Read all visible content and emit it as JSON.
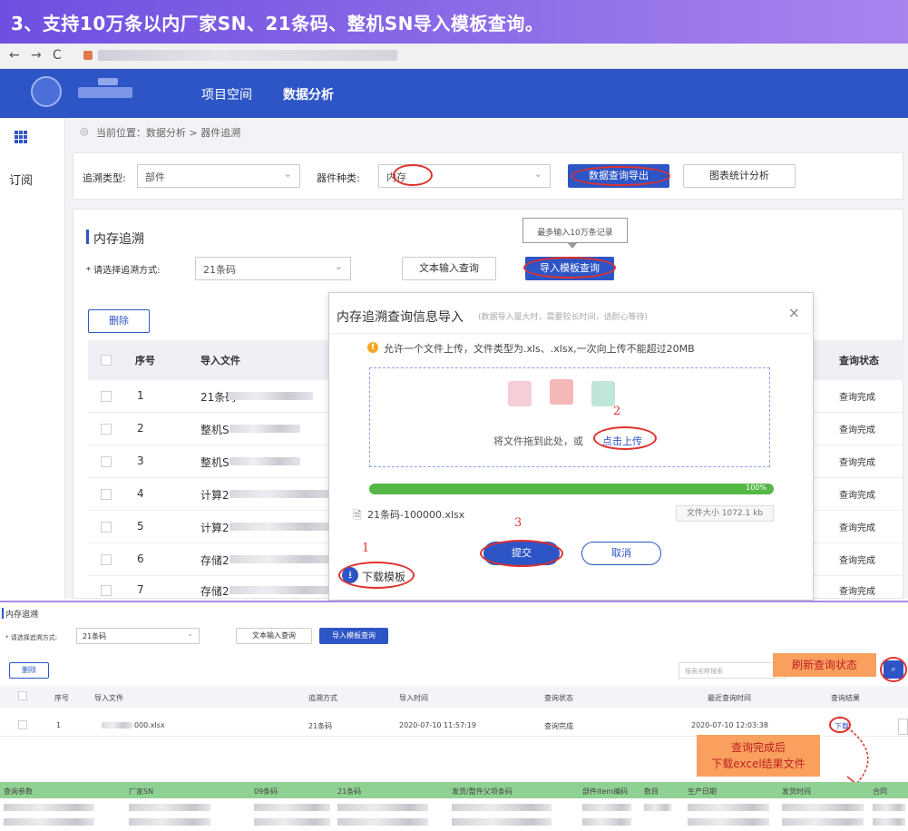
{
  "banner": {
    "title": "3、支持10万条以内厂家SN、21条码、整机SN导入模板查询。"
  },
  "browser": {
    "back": "←",
    "forward": "→",
    "reload": "C"
  },
  "topnav": {
    "items": [
      "项目空间",
      "数据分析"
    ]
  },
  "sidebar": {
    "sub_label": "订阅"
  },
  "breadcrumb": "当前位置：数据分析 > 器件追溯",
  "filter": {
    "trace_type_label": "追溯类型:",
    "trace_type_value": "部件",
    "device_type_label": "器件种类:",
    "device_type_value": "内存",
    "export_button": "数据查询导出",
    "chart_button": "图表统计分析"
  },
  "panel": {
    "title": "内存追溯",
    "method_label": "* 请选择追溯方式:",
    "method_value": "21条码",
    "text_query_button": "文本输入查询",
    "template_query_button": "导入模板查询",
    "tooltip": "最多输入10万条记录",
    "delete_button": "删除",
    "columns": [
      "序号",
      "导入文件",
      "查询状态"
    ],
    "rows": [
      {
        "no": "1",
        "file": "21条码",
        "status": "查询完成"
      },
      {
        "no": "2",
        "file": "整机S",
        "status": "查询完成"
      },
      {
        "no": "3",
        "file": "整机S",
        "status": "查询完成"
      },
      {
        "no": "4",
        "file": "计算2",
        "status": "查询完成"
      },
      {
        "no": "5",
        "file": "计算2",
        "status": "查询完成"
      },
      {
        "no": "6",
        "file": "存储2",
        "status": "查询完成"
      },
      {
        "no": "7",
        "file": "存储2",
        "status": "查询完成"
      }
    ]
  },
  "modal": {
    "title": "内存追溯查询信息导入",
    "subtitle": "(数据导入量大时，需要较长时间，请耐心等待)",
    "close": "×",
    "notice": "允许一个文件上传，文件类型为.xls、.xlsx,一次向上传不能超过20MB",
    "drop_text": "将文件拖到此处，或",
    "drop_link": "点击上传",
    "progress_percent": 100,
    "progress_label": "100%",
    "file_name": "21条码-100000.xlsx",
    "file_size": "文件大小 1072.1 kb",
    "submit_button": "提交",
    "cancel_button": "取消",
    "download_template": "下载模板",
    "step_marks": [
      "1",
      "2",
      "3"
    ]
  },
  "bottom": {
    "title": "内存追溯",
    "method_label": "* 请选择追溯方式:",
    "method_value": "21条码",
    "text_query_button": "文本输入查询",
    "template_query_button": "导入模板查询",
    "delete_button": "删除",
    "search_placeholder": "报表名称搜索",
    "refresh_callout": "刷新查询状态",
    "columns": [
      "序号",
      "导入文件",
      "追溯方式",
      "导入时间",
      "查询状态",
      "最近查询时间",
      "查询结果"
    ],
    "row": {
      "no": "1",
      "file": "000.xlsx",
      "method": "21条码",
      "import_time": "2020-07-10 11:57:19",
      "status": "查询完成",
      "last_query": "2020-07-10 12:03:38",
      "result": "下载"
    },
    "download_callout_line1": "查询完成后",
    "download_callout_line2": "下载excel结果文件",
    "result_columns": [
      "查询参数",
      "厂家SN",
      "09条码",
      "21条码",
      "发货/整件父项条码",
      "部件item编码",
      "数目",
      "生产日期",
      "发货时间",
      "合同"
    ]
  },
  "colors": {
    "brand": "#2e55c6",
    "banner": "#7b5be3",
    "alert": "#e0312c",
    "callout": "#f9a05f",
    "progress": "#55b846"
  }
}
